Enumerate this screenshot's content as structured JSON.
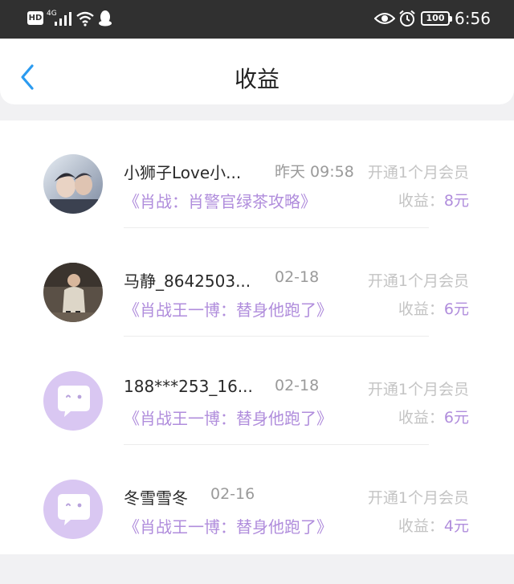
{
  "status_bar": {
    "hd": "HD",
    "network": "4G",
    "battery": "100",
    "time": "6:56"
  },
  "header": {
    "title": "收益"
  },
  "colors": {
    "accent_purple": "#b08ddc",
    "back_blue": "#2b9bf0",
    "placeholder_avatar": "#d9c7f2"
  },
  "items": [
    {
      "name": "小狮子Love小...",
      "time": "昨天 09:58",
      "member": "开通1个月会员",
      "book": "《肖战：肖警官绿茶攻略》",
      "earn_label": "收益：",
      "earn_value": "8元",
      "avatar": "photo-avatar"
    },
    {
      "name": "马静_8642503...",
      "time": "02-18",
      "member": "开通1个月会员",
      "book": "《肖战王一博：替身他跑了》",
      "earn_label": "收益：",
      "earn_value": "6元",
      "avatar": "photo-avatar"
    },
    {
      "name": "188***253_16...",
      "time": "02-18",
      "member": "开通1个月会员",
      "book": "《肖战王一博：替身他跑了》",
      "earn_label": "收益：",
      "earn_value": "6元",
      "avatar": "default-chat-avatar-icon"
    },
    {
      "name": "冬雪雪冬",
      "time": "02-16",
      "member": "开通1个月会员",
      "book": "《肖战王一博：替身他跑了》",
      "earn_label": "收益：",
      "earn_value": "4元",
      "avatar": "default-chat-avatar-icon"
    }
  ]
}
